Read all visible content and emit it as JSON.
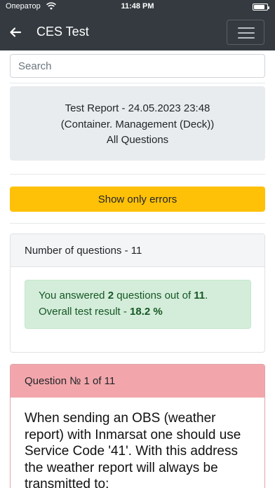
{
  "status_bar": {
    "carrier": "Оператор",
    "time": "11:48 PM",
    "battery_level": 0.85
  },
  "navbar": {
    "title": "CES Test",
    "back_icon": "arrow-left-icon",
    "menu_icon": "hamburger-menu-icon"
  },
  "search": {
    "placeholder": "Search",
    "value": ""
  },
  "report": {
    "line1": "Test Report - 24.05.2023 23:48",
    "line2": "(Container. Management (Deck))",
    "line3": "All Questions"
  },
  "errors_button": {
    "label": "Show only errors",
    "color": "#ffc107"
  },
  "summary": {
    "header": "Number of questions - 11",
    "answered_prefix": "You answered ",
    "answered_count": "2",
    "answered_middle": " questions out of ",
    "total_count": "11",
    "answered_suffix": ".",
    "result_prefix": "Overall test result - ",
    "result_value": "18.2 %"
  },
  "question": {
    "header": "Question № 1 of 11",
    "text": "When sending an OBS (weather report) with Inmarsat one should use Service Code '41'. With this address the weather report will always be transmitted to:",
    "header_color": "#f2a6ab"
  }
}
